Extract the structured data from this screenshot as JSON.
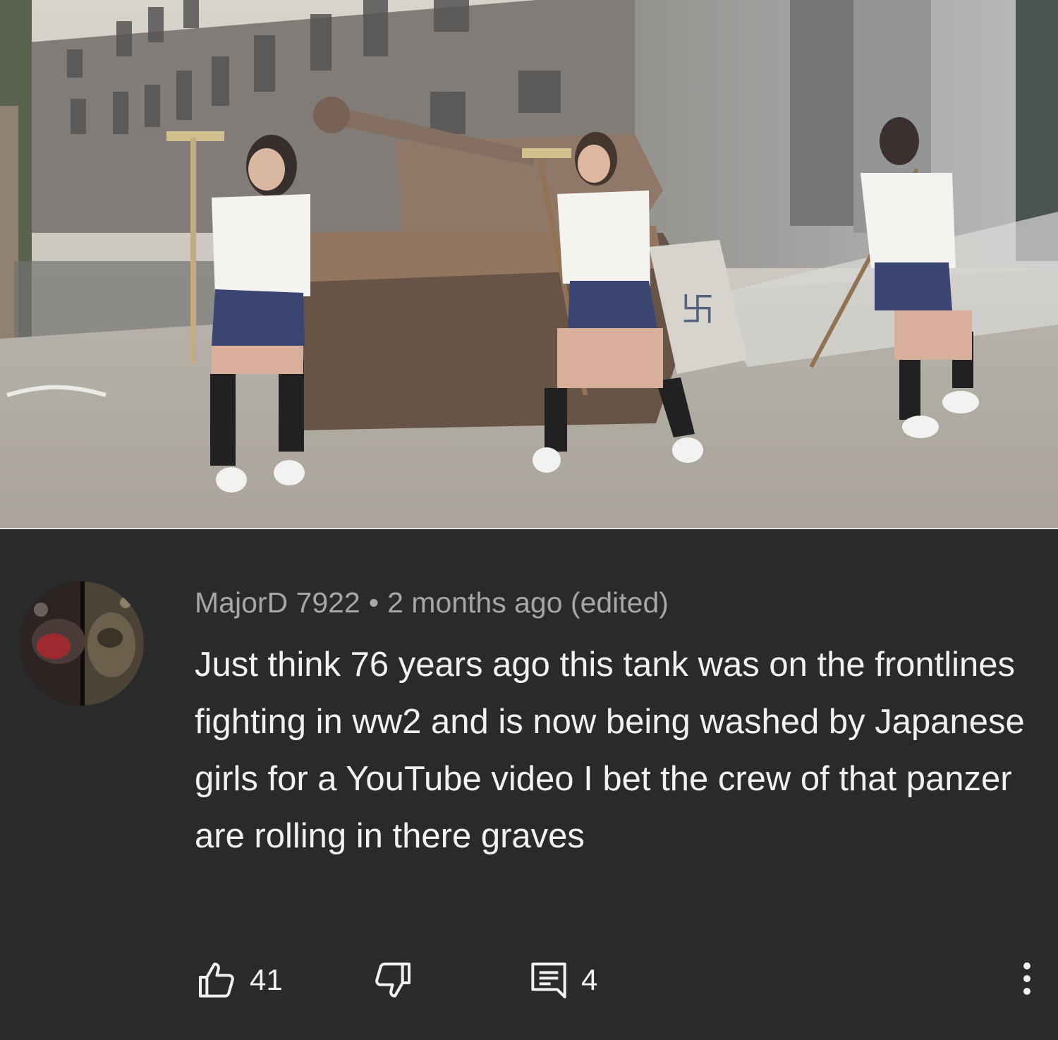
{
  "photo": {
    "description_icon": "photo-image"
  },
  "comment": {
    "author": "MajorD 7922",
    "separator": "•",
    "timestamp": "2 months ago (edited)",
    "text": "Just think 76 years ago this tank was on the frontlines fighting in ww2 and is now being washed by Japanese girls for a YouTube video I bet the crew of that panzer are rolling in there graves",
    "likes": "41",
    "replies": "4",
    "icons": {
      "like": "thumbs-up-icon",
      "dislike": "thumbs-down-icon",
      "reply": "comment-icon",
      "more": "more-vertical-icon"
    }
  },
  "colors": {
    "panel_bg": "#2a2a2a",
    "meta_text": "#a6a6a6",
    "body_text": "#f1f1f1"
  }
}
